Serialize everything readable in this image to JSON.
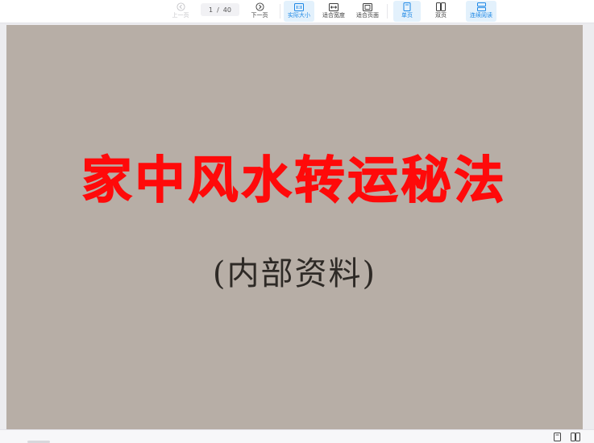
{
  "toolbar": {
    "prev_page": "上一页",
    "next_page": "下一页",
    "current_page": "1",
    "page_separator": "/",
    "total_pages": "40",
    "actual_size": "实际大小",
    "fit_width": "适合宽度",
    "fit_page": "适合页面",
    "single_page": "单页",
    "double_page": "双页",
    "continuous": "连续阅读"
  },
  "document": {
    "title": "家中风水转运秘法",
    "subtitle": "(内部资料)"
  },
  "colors": {
    "accent": "#1e88e5",
    "title_red": "#ff0a0a",
    "page_bg": "#b7aea6"
  },
  "icons": {
    "prev": "chevron-left-circle-icon",
    "next": "chevron-right-circle-icon",
    "actual_size": "one-to-one-icon",
    "fit_width": "fit-width-icon",
    "fit_page": "fit-page-icon",
    "single_page": "single-page-icon",
    "double_page": "double-page-icon",
    "continuous": "continuous-scroll-icon"
  }
}
